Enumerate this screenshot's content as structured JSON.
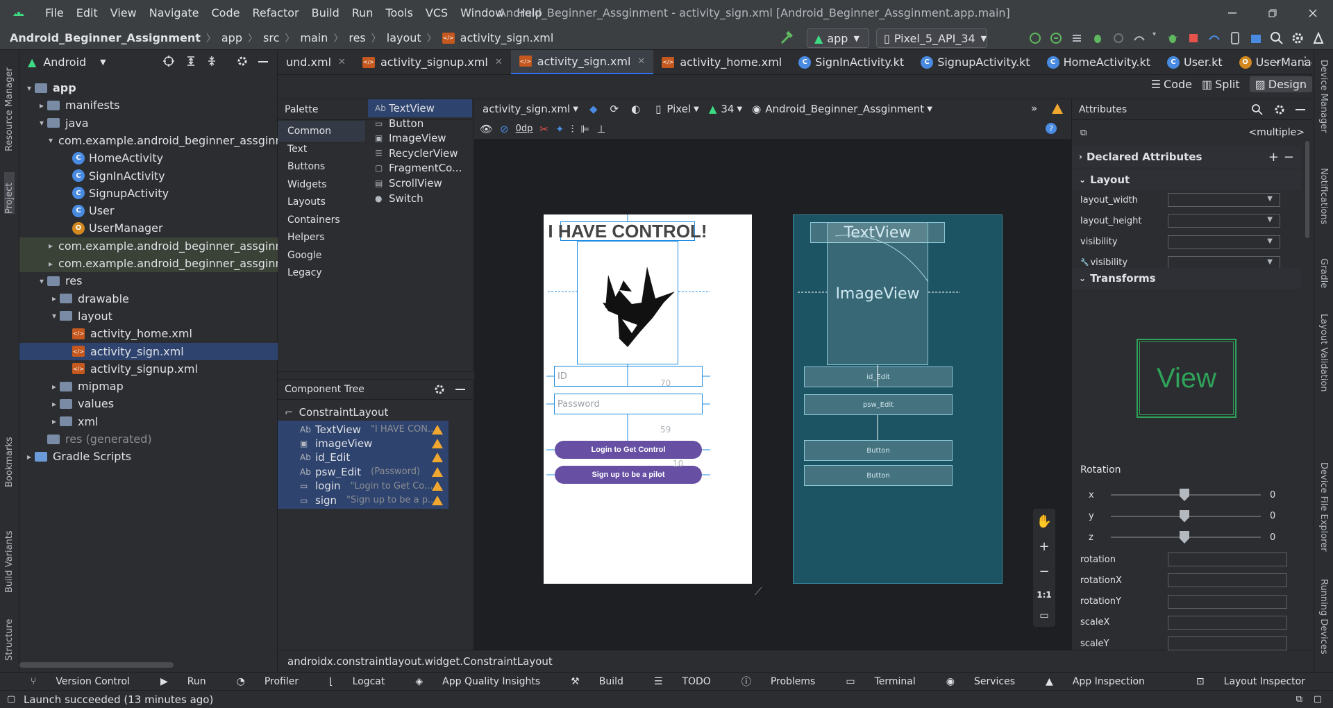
{
  "menu": [
    "File",
    "Edit",
    "View",
    "Navigate",
    "Code",
    "Refactor",
    "Build",
    "Run",
    "Tools",
    "VCS",
    "Window",
    "Help"
  ],
  "window_title": "Android_Beginner_Assginment - activity_sign.xml [Android_Beginner_Assginment.app.main]",
  "breadcrumb": [
    "Android_Beginner_Assignment",
    "app",
    "src",
    "main",
    "res",
    "layout",
    "activity_sign.xml"
  ],
  "run_config": "app",
  "device": "Pixel_5_API_34",
  "project_panel": {
    "title": "Android",
    "view": "Android"
  },
  "tree": [
    {
      "label": "app",
      "depth": 0,
      "arrow": "▾",
      "kind": "folder",
      "bold": true
    },
    {
      "label": "manifests",
      "depth": 1,
      "arrow": "▸",
      "kind": "folder"
    },
    {
      "label": "java",
      "depth": 1,
      "arrow": "▾",
      "kind": "folder"
    },
    {
      "label": "com.example.android_beginner_assginm",
      "depth": 2,
      "arrow": "▾",
      "kind": "package"
    },
    {
      "label": "HomeActivity",
      "depth": 3,
      "arrow": "",
      "kind": "class"
    },
    {
      "label": "SignInActivity",
      "depth": 3,
      "arrow": "",
      "kind": "class"
    },
    {
      "label": "SignupActivity",
      "depth": 3,
      "arrow": "",
      "kind": "class"
    },
    {
      "label": "User",
      "depth": 3,
      "arrow": "",
      "kind": "class"
    },
    {
      "label": "UserManager",
      "depth": 3,
      "arrow": "",
      "kind": "object"
    },
    {
      "label": "com.example.android_beginner_assginm",
      "depth": 2,
      "arrow": "▸",
      "kind": "package",
      "group": true
    },
    {
      "label": "com.example.android_beginner_assginm",
      "depth": 2,
      "arrow": "▸",
      "kind": "package",
      "group": true
    },
    {
      "label": "res",
      "depth": 1,
      "arrow": "▾",
      "kind": "folder"
    },
    {
      "label": "drawable",
      "depth": 2,
      "arrow": "▸",
      "kind": "folder"
    },
    {
      "label": "layout",
      "depth": 2,
      "arrow": "▾",
      "kind": "folder"
    },
    {
      "label": "activity_home.xml",
      "depth": 3,
      "arrow": "",
      "kind": "xml"
    },
    {
      "label": "activity_sign.xml",
      "depth": 3,
      "arrow": "",
      "kind": "xml",
      "selected": true
    },
    {
      "label": "activity_signup.xml",
      "depth": 3,
      "arrow": "",
      "kind": "xml"
    },
    {
      "label": "mipmap",
      "depth": 2,
      "arrow": "▸",
      "kind": "folder"
    },
    {
      "label": "values",
      "depth": 2,
      "arrow": "▸",
      "kind": "folder"
    },
    {
      "label": "xml",
      "depth": 2,
      "arrow": "▸",
      "kind": "folder"
    },
    {
      "label": "res (generated)",
      "depth": 1,
      "arrow": "",
      "kind": "folder",
      "dim": true
    },
    {
      "label": "Gradle Scripts",
      "depth": 0,
      "arrow": "▸",
      "kind": "gradle"
    }
  ],
  "editor_tabs": [
    {
      "label": "und.xml",
      "active": false,
      "kind": "xml"
    },
    {
      "label": "activity_signup.xml",
      "active": false,
      "kind": "xml"
    },
    {
      "label": "activity_sign.xml",
      "active": true,
      "kind": "xml"
    },
    {
      "label": "activity_home.xml",
      "active": false,
      "kind": "xml"
    },
    {
      "label": "SignInActivity.kt",
      "active": false,
      "kind": "kt"
    },
    {
      "label": "SignupActivity.kt",
      "active": false,
      "kind": "kt"
    },
    {
      "label": "HomeActivity.kt",
      "active": false,
      "kind": "kt"
    },
    {
      "label": "User.kt",
      "active": false,
      "kind": "kt"
    },
    {
      "label": "UserManager.kt",
      "active": false,
      "kind": "kto"
    }
  ],
  "view_modes": [
    "Code",
    "Split",
    "Design"
  ],
  "palette": {
    "title": "Palette",
    "categories": [
      "Common",
      "Text",
      "Buttons",
      "Widgets",
      "Layouts",
      "Containers",
      "Helpers",
      "Google",
      "Legacy"
    ],
    "items": [
      {
        "icon": "Ab",
        "label": "TextView"
      },
      {
        "icon": "▭",
        "label": "Button"
      },
      {
        "icon": "▣",
        "label": "ImageView"
      },
      {
        "icon": "☰",
        "label": "RecyclerView"
      },
      {
        "icon": "▢",
        "label": "FragmentCo..."
      },
      {
        "icon": "▤",
        "label": "ScrollView"
      },
      {
        "icon": "●",
        "label": "Switch"
      }
    ]
  },
  "component_tree": {
    "title": "Component Tree",
    "root": "ConstraintLayout",
    "items": [
      {
        "icon": "Ab",
        "label": "TextView",
        "hint": "\"I HAVE CON..."
      },
      {
        "icon": "▣",
        "label": "imageView",
        "hint": ""
      },
      {
        "icon": "Ab",
        "label": "id_Edit",
        "hint": ""
      },
      {
        "icon": "Ab",
        "label": "psw_Edit",
        "hint": "(Password)"
      },
      {
        "icon": "▭",
        "label": "login",
        "hint": "\"Login to Get Co..."
      },
      {
        "icon": "▭",
        "label": "sign",
        "hint": "\"Sign up to be a p..."
      }
    ]
  },
  "canvas_toolbar": {
    "file": "activity_sign.xml",
    "device": "Pixel",
    "api": "34",
    "theme": "Android_Beginner_Assginment",
    "margin": "0dp"
  },
  "design": {
    "title_text": "I HAVE CONTROL!",
    "id_hint": "ID",
    "psw_hint": "Password",
    "login_label": "Login to Get Control",
    "sign_label": "Sign up to be a pilot",
    "margin_a": "70",
    "margin_b": "59",
    "margin_c": "10"
  },
  "blueprint": {
    "textview": "TextView",
    "imageview": "ImageView",
    "id_edit": "id_Edit",
    "psw_edit": "psw_Edit",
    "button1": "Button",
    "button2": "Button"
  },
  "zoom": {
    "fit": "1:1"
  },
  "attributes": {
    "title": "Attributes",
    "selection": "<multiple>",
    "declared": "Declared Attributes",
    "layout": "Layout",
    "layout_rows": [
      "layout_width",
      "layout_height",
      "visibility",
      "visibility"
    ],
    "transforms": "Transforms",
    "view_label": "View",
    "rotation": "Rotation",
    "axes": [
      {
        "axis": "x",
        "value": "0"
      },
      {
        "axis": "y",
        "value": "0"
      },
      {
        "axis": "z",
        "value": "0"
      }
    ],
    "transform_rows": [
      "rotation",
      "rotationX",
      "rotationY",
      "scaleX",
      "scaleY"
    ]
  },
  "status_path": "androidx.constraintlayout.widget.ConstraintLayout",
  "bottom_tools": [
    "Version Control",
    "Run",
    "Profiler",
    "Logcat",
    "App Quality Insights",
    "Build",
    "TODO",
    "Problems",
    "Terminal",
    "Services",
    "App Inspection"
  ],
  "layout_inspector": "Layout Inspector",
  "status": "Launch succeeded (13 minutes ago)",
  "left_strip": [
    "Resource Manager",
    "Project",
    "Bookmarks",
    "Build Variants",
    "Structure"
  ],
  "right_strip": [
    "Device Manager",
    "Notifications",
    "Gradle",
    "Layout Validation",
    "Device File Explorer",
    "Running Devices"
  ],
  "colors": {
    "accent": "#3574f0",
    "button": "#6750a4",
    "warning": "#f0a730",
    "blueprint": "#1d5463"
  }
}
